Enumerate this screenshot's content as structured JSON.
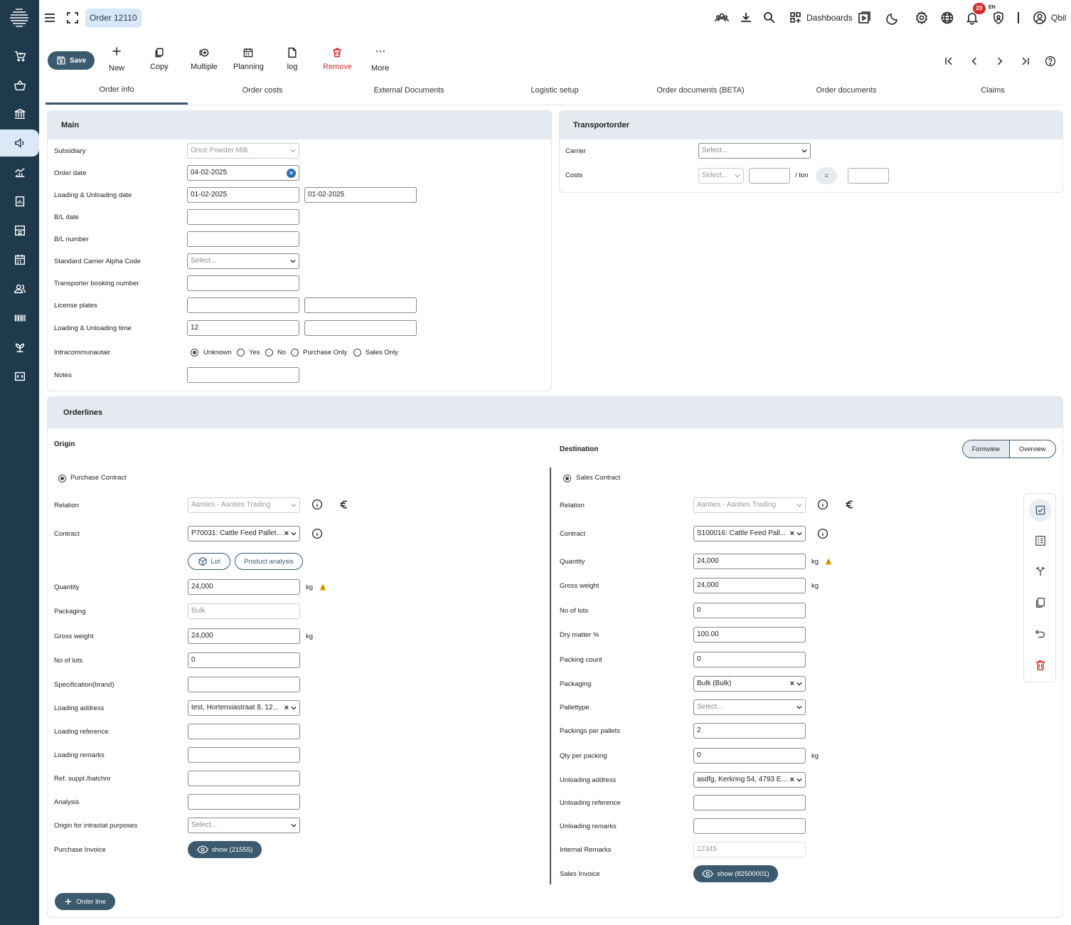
{
  "topbar": {
    "order_chip": "Order 12110",
    "dashboards": "Dashboards",
    "language": "EN",
    "notifications": "20",
    "user": "Qbil"
  },
  "toolbar": {
    "save": "Save",
    "new": "New",
    "copy": "Copy",
    "multiple": "Multiple",
    "planning": "Planning",
    "log": "log",
    "remove": "Remove",
    "more": "More"
  },
  "tabs": [
    "Order info",
    "Order costs",
    "External Documents",
    "Logistic setup",
    "Order documents (BETA)",
    "Order documents",
    "Claims"
  ],
  "main": {
    "title": "Main",
    "subsidiary_label": "Subsidiary",
    "subsidiary_value": "Once Powder Milk",
    "order_date_label": "Order date",
    "order_date_value": "04-02-2025",
    "lu_date_label": "Loading & Unloading date",
    "loading_date": "01-02-2025",
    "unloading_date": "01-02-2025",
    "bl_date_label": "B/L date",
    "bl_number_label": "B/L number",
    "scac_label": "Standard Carrier Alpha Code",
    "scac_value": "Select...",
    "booking_label": "Transporter booking number",
    "plates_label": "License plates",
    "lu_time_label": "Loading & Unloading time",
    "loading_time": "12",
    "intra_label": "Intracommunautair",
    "intra_options": [
      "Unknown",
      "Yes",
      "No",
      "Purchase Only",
      "Sales Only"
    ],
    "notes_label": "Notes"
  },
  "transport": {
    "title": "Transportorder",
    "carrier_label": "Carrier",
    "carrier_value": "Select...",
    "costs_label": "Costs",
    "costs_select": "Select...",
    "per_ton": "/ ton",
    "equals": "="
  },
  "orderlines": {
    "title": "Orderlines",
    "origin_title": "Origin",
    "destination_title": "Destination",
    "formview": "Formview",
    "overview": "Overview",
    "add_line": "Order line",
    "origin": {
      "contract_type": "Purchase Contract",
      "relation_label": "Relation",
      "relation_value": "Aanties - Aanties Trading",
      "contract_label": "Contract",
      "contract_value": "P70031: Cattle Feed Pallet...",
      "lot_btn": "Lot",
      "analysis_btn": "Product analysis",
      "quantity_label": "Quantity",
      "quantity_value": "24,000",
      "unit": "kg",
      "packaging_label": "Packaging",
      "packaging_value": "Bulk",
      "gross_label": "Gross weight",
      "gross_value": "24,000",
      "lots_label": "No of lots",
      "lots_value": "0",
      "spec_label": "Specification(brand)",
      "load_addr_label": "Loading address",
      "load_addr_value": "test, Hortensiastraat 8, 12...",
      "load_ref_label": "Loading reference",
      "load_rem_label": "Loading remarks",
      "ref_label": "Ref. suppl./batchnr",
      "analysis_label": "Analysis",
      "intrastat_label": "Origin for intrastat purposes",
      "intrastat_value": "Select...",
      "invoice_label": "Purchase Invoice",
      "invoice_btn": "show (21555)"
    },
    "destination": {
      "contract_type": "Sales Contract",
      "relation_label": "Relation",
      "relation_value": "Aanties - Aanties Trading",
      "contract_label": "Contract",
      "contract_value": "S100016: Cattle Feed Pall...",
      "quantity_label": "Quantity",
      "quantity_value": "24,000",
      "unit": "kg",
      "gross_label": "Gross weight",
      "gross_value": "24,000",
      "lots_label": "No of lots",
      "lots_value": "0",
      "dry_label": "Dry matter %",
      "dry_value": "100.00",
      "pack_count_label": "Packing count",
      "pack_count_value": "0",
      "packaging_label": "Packaging",
      "packaging_value": "Bulk (Bulk)",
      "pallet_label": "Pallettype",
      "pallet_value": "Select...",
      "ppp_label": "Packings per pallets",
      "ppp_value": "2",
      "qpp_label": "Qty per packing",
      "qpp_value": "0",
      "unload_addr_label": "Unloading address",
      "unload_addr_value": "asdfg, Kerkring 54, 4793 E...",
      "unload_ref_label": "Unloading reference",
      "unload_rem_label": "Unloading remarks",
      "internal_label": "Internal Remarks",
      "internal_value": "12345",
      "invoice_label": "Sales Invoice",
      "invoice_btn": "show (82500001)"
    }
  }
}
